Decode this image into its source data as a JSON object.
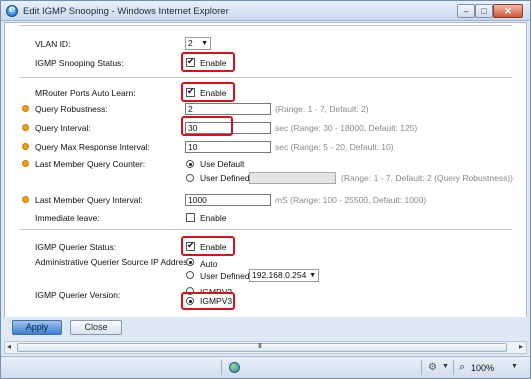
{
  "window": {
    "title": "Edit IGMP Snooping - Windows Internet Explorer",
    "min_glyph": "–",
    "max_glyph": "□",
    "close_glyph": "✕"
  },
  "form": {
    "vlan_id": {
      "label": "VLAN ID:",
      "value": "2"
    },
    "snooping_status": {
      "label": "IGMP Snooping Status:",
      "checkbox_label": "Enable",
      "checked": true
    },
    "mrouter_auto_learn": {
      "label": "MRouter Ports Auto Learn:",
      "checkbox_label": "Enable",
      "checked": true
    },
    "query_robustness": {
      "label": "Query Robustness:",
      "value": "2",
      "hint": "(Range: 1 - 7, Default: 2)"
    },
    "query_interval": {
      "label": "Query Interval:",
      "value": "30",
      "hint": "sec (Range: 30 - 18000, Default: 125)"
    },
    "query_max_response": {
      "label": "Query Max Response Interval:",
      "value": "10",
      "hint": "sec (Range: 5 - 20, Default: 10)"
    },
    "last_member_counter": {
      "label": "Last Member Query Counter:",
      "option_default": "Use Default",
      "option_user": "User Defined",
      "selected": "Use Default",
      "value": "",
      "hint": "(Range: 1 - 7, Default: 2 (Query Robustness))"
    },
    "last_member_interval": {
      "label": "Last Member Query Interval:",
      "value": "1000",
      "hint": "mS (Range: 100 - 25500, Default: 1000)"
    },
    "immediate_leave": {
      "label": "Immediate leave:",
      "checkbox_label": "Enable",
      "checked": false
    },
    "querier_status": {
      "label": "IGMP Querier Status:",
      "checkbox_label": "Enable",
      "checked": true
    },
    "admin_querier_ip": {
      "label": "Administrative Querier Source IP Address:",
      "option_auto": "Auto",
      "option_user": "User Defined",
      "selected": "Auto",
      "ip_value": "192.168.0.254"
    },
    "querier_version": {
      "label": "IGMP Querier Version:",
      "option_v2": "IGMPV2",
      "option_v3": "IGMPV3",
      "selected": "IGMPV3"
    }
  },
  "buttons": {
    "apply": "Apply",
    "close": "Close"
  },
  "scrollbar": {
    "left_arrow": "◂",
    "right_arrow": "▸",
    "grip": "III"
  },
  "statusbar": {
    "zoom": "100%",
    "zone_icon": "globe-icon",
    "zoom_icon": "magnifier-icon"
  },
  "colors": {
    "highlight_red": "#d8101e",
    "required_dot": "#f0a21b",
    "apply_blue": "#3d7fd0"
  }
}
